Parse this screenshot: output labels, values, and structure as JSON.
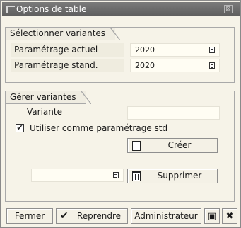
{
  "window": {
    "title": "Options de table",
    "close_glyph": "⊠"
  },
  "select_variants": {
    "header": "Sélectionner variantes",
    "current": {
      "label": "Paramétrage actuel",
      "value": "2020"
    },
    "standard": {
      "label": "Paramétrage stand.",
      "value": "2020"
    }
  },
  "manage_variants": {
    "header": "Gérer variantes",
    "variant_label": "Variante",
    "variant_value": "",
    "checkbox_mark": "✔",
    "use_as_std_label": "Utiliser comme paramétrage std",
    "create_button": "Créer",
    "delete_field_value": "",
    "delete_button": "Supprimer"
  },
  "footer": {
    "close_button": "Fermer",
    "apply_icon": "✔",
    "apply_button": "Reprendre",
    "admin_button": "Administrateur",
    "save_icon": "▣",
    "cancel_icon": "✖"
  },
  "icons": {
    "app": "window-icon",
    "picker": "value-help-icon",
    "create": "new-document-icon",
    "delete": "trash-icon",
    "save": "save-icon",
    "cancel": "cancel-icon"
  }
}
